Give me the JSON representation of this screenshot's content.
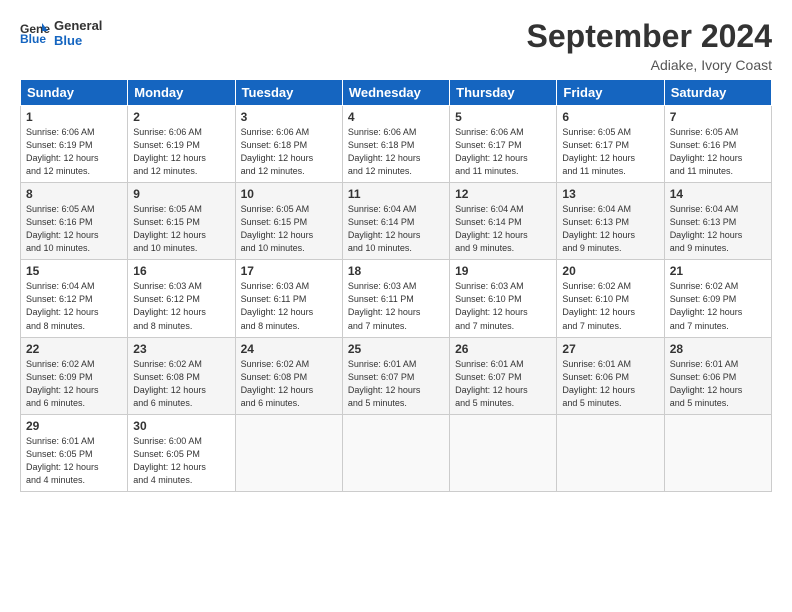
{
  "logo": {
    "line1": "General",
    "line2": "Blue"
  },
  "title": "September 2024",
  "location": "Adiake, Ivory Coast",
  "weekdays": [
    "Sunday",
    "Monday",
    "Tuesday",
    "Wednesday",
    "Thursday",
    "Friday",
    "Saturday"
  ],
  "weeks": [
    [
      {
        "day": "1",
        "info": "Sunrise: 6:06 AM\nSunset: 6:19 PM\nDaylight: 12 hours\nand 12 minutes."
      },
      {
        "day": "2",
        "info": "Sunrise: 6:06 AM\nSunset: 6:19 PM\nDaylight: 12 hours\nand 12 minutes."
      },
      {
        "day": "3",
        "info": "Sunrise: 6:06 AM\nSunset: 6:18 PM\nDaylight: 12 hours\nand 12 minutes."
      },
      {
        "day": "4",
        "info": "Sunrise: 6:06 AM\nSunset: 6:18 PM\nDaylight: 12 hours\nand 12 minutes."
      },
      {
        "day": "5",
        "info": "Sunrise: 6:06 AM\nSunset: 6:17 PM\nDaylight: 12 hours\nand 11 minutes."
      },
      {
        "day": "6",
        "info": "Sunrise: 6:05 AM\nSunset: 6:17 PM\nDaylight: 12 hours\nand 11 minutes."
      },
      {
        "day": "7",
        "info": "Sunrise: 6:05 AM\nSunset: 6:16 PM\nDaylight: 12 hours\nand 11 minutes."
      }
    ],
    [
      {
        "day": "8",
        "info": "Sunrise: 6:05 AM\nSunset: 6:16 PM\nDaylight: 12 hours\nand 10 minutes."
      },
      {
        "day": "9",
        "info": "Sunrise: 6:05 AM\nSunset: 6:15 PM\nDaylight: 12 hours\nand 10 minutes."
      },
      {
        "day": "10",
        "info": "Sunrise: 6:05 AM\nSunset: 6:15 PM\nDaylight: 12 hours\nand 10 minutes."
      },
      {
        "day": "11",
        "info": "Sunrise: 6:04 AM\nSunset: 6:14 PM\nDaylight: 12 hours\nand 10 minutes."
      },
      {
        "day": "12",
        "info": "Sunrise: 6:04 AM\nSunset: 6:14 PM\nDaylight: 12 hours\nand 9 minutes."
      },
      {
        "day": "13",
        "info": "Sunrise: 6:04 AM\nSunset: 6:13 PM\nDaylight: 12 hours\nand 9 minutes."
      },
      {
        "day": "14",
        "info": "Sunrise: 6:04 AM\nSunset: 6:13 PM\nDaylight: 12 hours\nand 9 minutes."
      }
    ],
    [
      {
        "day": "15",
        "info": "Sunrise: 6:04 AM\nSunset: 6:12 PM\nDaylight: 12 hours\nand 8 minutes."
      },
      {
        "day": "16",
        "info": "Sunrise: 6:03 AM\nSunset: 6:12 PM\nDaylight: 12 hours\nand 8 minutes."
      },
      {
        "day": "17",
        "info": "Sunrise: 6:03 AM\nSunset: 6:11 PM\nDaylight: 12 hours\nand 8 minutes."
      },
      {
        "day": "18",
        "info": "Sunrise: 6:03 AM\nSunset: 6:11 PM\nDaylight: 12 hours\nand 7 minutes."
      },
      {
        "day": "19",
        "info": "Sunrise: 6:03 AM\nSunset: 6:10 PM\nDaylight: 12 hours\nand 7 minutes."
      },
      {
        "day": "20",
        "info": "Sunrise: 6:02 AM\nSunset: 6:10 PM\nDaylight: 12 hours\nand 7 minutes."
      },
      {
        "day": "21",
        "info": "Sunrise: 6:02 AM\nSunset: 6:09 PM\nDaylight: 12 hours\nand 7 minutes."
      }
    ],
    [
      {
        "day": "22",
        "info": "Sunrise: 6:02 AM\nSunset: 6:09 PM\nDaylight: 12 hours\nand 6 minutes."
      },
      {
        "day": "23",
        "info": "Sunrise: 6:02 AM\nSunset: 6:08 PM\nDaylight: 12 hours\nand 6 minutes."
      },
      {
        "day": "24",
        "info": "Sunrise: 6:02 AM\nSunset: 6:08 PM\nDaylight: 12 hours\nand 6 minutes."
      },
      {
        "day": "25",
        "info": "Sunrise: 6:01 AM\nSunset: 6:07 PM\nDaylight: 12 hours\nand 5 minutes."
      },
      {
        "day": "26",
        "info": "Sunrise: 6:01 AM\nSunset: 6:07 PM\nDaylight: 12 hours\nand 5 minutes."
      },
      {
        "day": "27",
        "info": "Sunrise: 6:01 AM\nSunset: 6:06 PM\nDaylight: 12 hours\nand 5 minutes."
      },
      {
        "day": "28",
        "info": "Sunrise: 6:01 AM\nSunset: 6:06 PM\nDaylight: 12 hours\nand 5 minutes."
      }
    ],
    [
      {
        "day": "29",
        "info": "Sunrise: 6:01 AM\nSunset: 6:05 PM\nDaylight: 12 hours\nand 4 minutes."
      },
      {
        "day": "30",
        "info": "Sunrise: 6:00 AM\nSunset: 6:05 PM\nDaylight: 12 hours\nand 4 minutes."
      },
      {
        "day": "",
        "info": ""
      },
      {
        "day": "",
        "info": ""
      },
      {
        "day": "",
        "info": ""
      },
      {
        "day": "",
        "info": ""
      },
      {
        "day": "",
        "info": ""
      }
    ]
  ]
}
